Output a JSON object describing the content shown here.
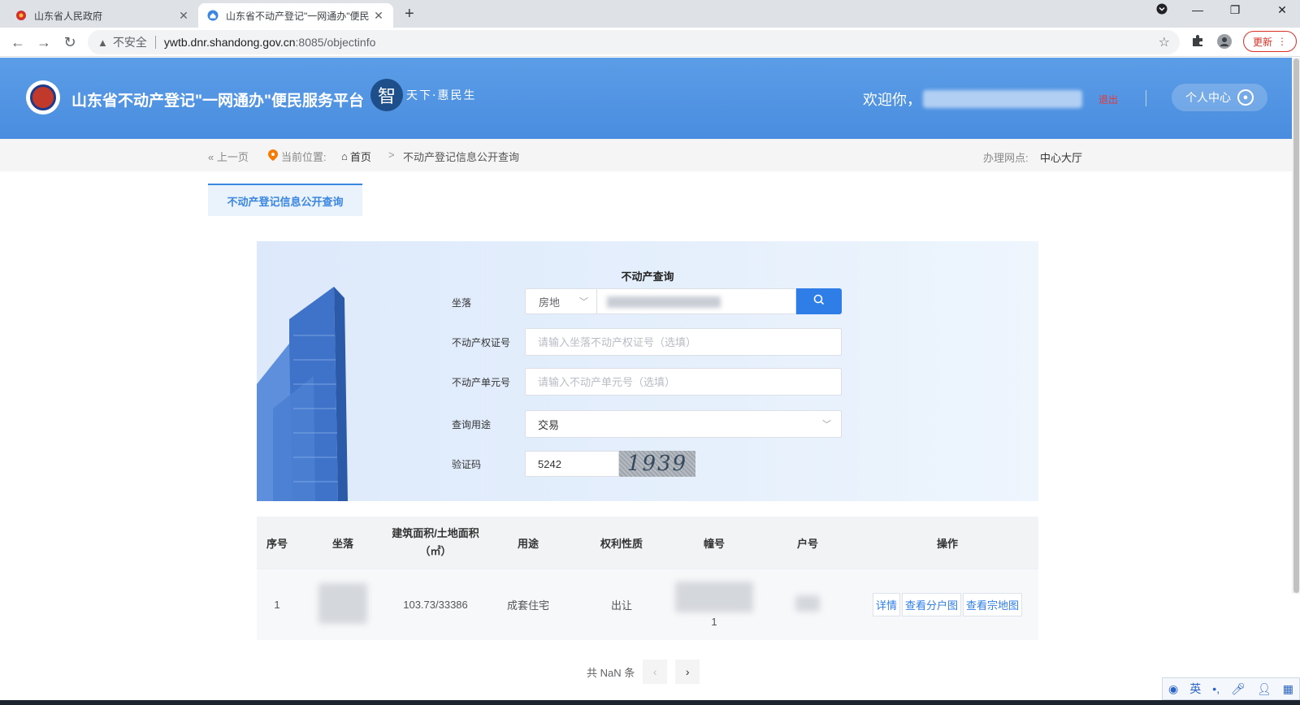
{
  "browser": {
    "tabs": [
      {
        "title": "山东省人民政府",
        "active": false
      },
      {
        "title": "山东省不动产登记\"一网通办\"便民",
        "active": true
      }
    ],
    "new_tab_symbol": "+",
    "security_label": "不安全",
    "url_host": "ywtb.dnr.shandong.gov.cn",
    "url_rest": ":8085/objectinfo",
    "update_label": "更新"
  },
  "header": {
    "site_title": "山东省不动产登记\"一网通办\"便民服务平台",
    "slogan_char": "智",
    "slogan_rest": "天下·惠民生",
    "welcome": "欢迎你，",
    "logout": "退出",
    "personal_center": "个人中心"
  },
  "breadcrumb": {
    "back": "上一页",
    "location_label": "当前位置:",
    "home": "首页",
    "separator": ">",
    "current": "不动产登记信息公开查询",
    "office_label": "办理网点:",
    "office_value": "中心大厅"
  },
  "page_tab": "不动产登记信息公开查询",
  "form": {
    "title": "不动产查询",
    "location_label": "坐落",
    "location_type": "房地",
    "cert_label": "不动产权证号",
    "cert_placeholder": "请输入坐落不动产权证号（选填）",
    "unit_label": "不动产单元号",
    "unit_placeholder": "请输入不动产单元号（选填）",
    "purpose_label": "查询用途",
    "purpose_value": "交易",
    "captcha_label": "验证码",
    "captcha_input": "5242",
    "captcha_image_text": "1939"
  },
  "table": {
    "headers": [
      "序号",
      "坐落",
      "建筑面积/土地面积（㎡）",
      "用途",
      "权利性质",
      "幢号",
      "户号",
      "操作"
    ],
    "rows": [
      {
        "index": "1",
        "area": "103.73/33386",
        "usage": "成套住宅",
        "right_type": "出让",
        "building_suffix": "1"
      }
    ],
    "actions": [
      "详情",
      "查看分户图",
      "查看宗地图"
    ]
  },
  "pagination": {
    "total_text": "共 NaN 条",
    "prev": "‹",
    "next": "›"
  },
  "ime": {
    "lang": "英"
  },
  "colors": {
    "header_blue": "#4a8de0",
    "accent": "#2f7ee8",
    "logout_red": "#e53935"
  }
}
